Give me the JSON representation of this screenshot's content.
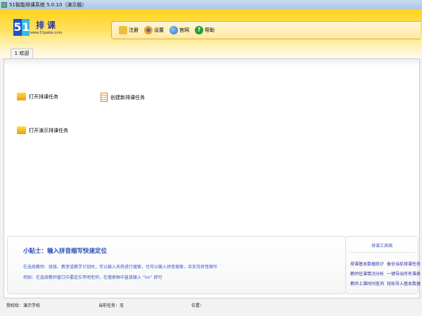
{
  "window": {
    "title": "51智能排课系统 5.0.10（演示版）"
  },
  "logo": {
    "digits": [
      "5",
      "1"
    ],
    "text": "排课",
    "url": "www.51paike.com"
  },
  "toolbar": {
    "items": [
      {
        "label": "注册",
        "icon": "register-icon",
        "color": "#e8c040"
      },
      {
        "label": "设置",
        "icon": "gear-icon",
        "color": "#f0a020"
      },
      {
        "label": "官网",
        "icon": "globe-icon",
        "color": "#3a7ad8"
      },
      {
        "label": "帮助",
        "icon": "help-icon",
        "color": "#2a9a30"
      }
    ]
  },
  "tabs": [
    {
      "label": "1 欢迎"
    }
  ],
  "actions": {
    "open": "打开排课任务",
    "create": "创建新排课任务",
    "open_demo": "打开演示排课任务"
  },
  "tips": {
    "title": "小贴士：输入拼音缩写快速定位",
    "line1": "在选择教师、班级、教室或教学计划时，可以输入名称进行搜索，也可以输入拼音搜索，且支持拼音缩写",
    "line2": "例如：在选择教师窗口中要定位李明老师，在搜索框中直接输入 “lm” 即可"
  },
  "toolbox": {
    "title": "排课工具箱",
    "links": [
      "排课基本数据统计",
      "备份当前排课任务",
      "教师任课情况分析",
      "一键导出所有课表",
      "教师上课时间查询",
      "轻松导入基本数据"
    ]
  },
  "status": {
    "licensed": "授权给：演示学校",
    "task": "当前任务：无",
    "position": "位置："
  }
}
